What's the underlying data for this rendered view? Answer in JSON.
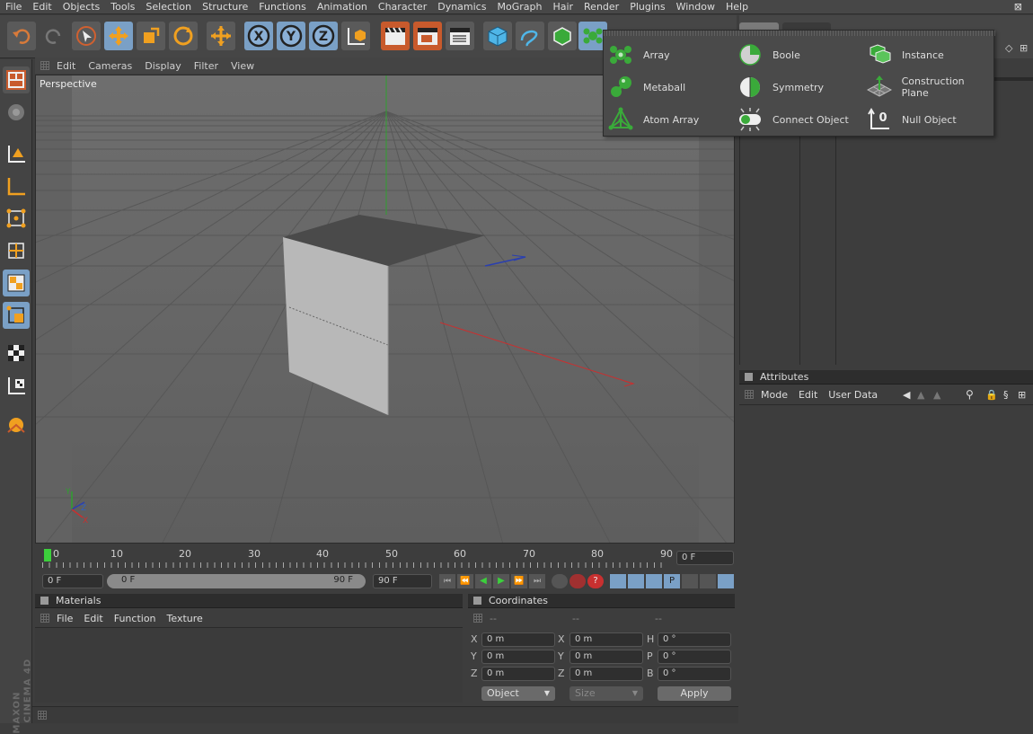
{
  "menu": [
    "File",
    "Edit",
    "Objects",
    "Tools",
    "Selection",
    "Structure",
    "Functions",
    "Animation",
    "Character",
    "Dynamics",
    "MoGraph",
    "Hair",
    "Render",
    "Plugins",
    "Window",
    "Help"
  ],
  "viewport": {
    "menu": [
      "Edit",
      "Cameras",
      "Display",
      "Filter",
      "View"
    ],
    "label": "Perspective"
  },
  "popup": {
    "items": [
      {
        "label": "Array",
        "icon": "array-icon"
      },
      {
        "label": "Metaball",
        "icon": "metaball-icon"
      },
      {
        "label": "Atom Array",
        "icon": "atom-array-icon"
      },
      {
        "label": "Boole",
        "icon": "boole-icon"
      },
      {
        "label": "Symmetry",
        "icon": "symmetry-icon"
      },
      {
        "label": "Connect Object",
        "icon": "connect-object-icon"
      },
      {
        "label": "Instance",
        "icon": "instance-icon"
      },
      {
        "label": "Construction Plane",
        "icon": "construction-plane-icon"
      },
      {
        "label": "Null Object",
        "icon": "null-object-icon"
      }
    ]
  },
  "timeline": {
    "ticks": [
      "0",
      "10",
      "20",
      "30",
      "40",
      "50",
      "60",
      "70",
      "80",
      "90"
    ],
    "current_frame": "0 F",
    "start_field": "0 F",
    "range_start": "0 F",
    "range_end": "90 F",
    "end_field": "90 F"
  },
  "materials": {
    "title": "Materials",
    "menu": [
      "File",
      "Edit",
      "Function",
      "Texture"
    ]
  },
  "coordinates": {
    "title": "Coordinates",
    "headers": [
      "--",
      "--",
      "--"
    ],
    "rows": [
      {
        "a": "X",
        "av": "0 m",
        "b": "X",
        "bv": "0 m",
        "c": "H",
        "cv": "0 °"
      },
      {
        "a": "Y",
        "av": "0 m",
        "b": "Y",
        "bv": "0 m",
        "c": "P",
        "cv": "0 °"
      },
      {
        "a": "Z",
        "av": "0 m",
        "b": "Z",
        "bv": "0 m",
        "c": "B",
        "cv": "0 °"
      }
    ],
    "mode_select": "Object",
    "size_select": "Size",
    "apply_label": "Apply"
  },
  "attributes": {
    "title": "Attributes",
    "menu": [
      "Mode",
      "Edit",
      "User Data"
    ]
  },
  "brand": {
    "line1": "MAXON",
    "line2": "CINEMA 4D"
  },
  "colors": {
    "accent": "#7aa0c6",
    "axis_x": "#c83030",
    "axis_y": "#2fa02f",
    "axis_z": "#2a3fb0"
  }
}
